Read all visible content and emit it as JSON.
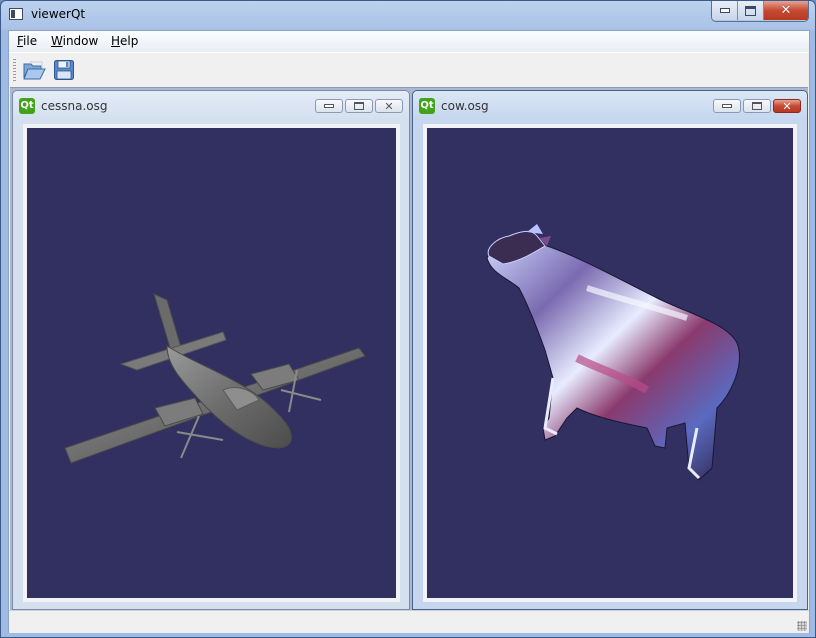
{
  "window": {
    "title": "viewerQt",
    "controls": {
      "minimize": "minimize",
      "maximize": "maximize",
      "close": "close"
    }
  },
  "menubar": {
    "items": [
      {
        "label": "File",
        "mnemonic": "F",
        "rest": "ile"
      },
      {
        "label": "Window",
        "mnemonic": "W",
        "rest": "indow"
      },
      {
        "label": "Help",
        "mnemonic": "H",
        "rest": "elp"
      }
    ]
  },
  "toolbar": {
    "buttons": [
      {
        "name": "open",
        "icon": "folder-open-icon"
      },
      {
        "name": "save",
        "icon": "floppy-disk-icon"
      }
    ]
  },
  "subwindows": [
    {
      "title": "cessna.osg",
      "icon": "qt-logo-icon",
      "logo_text": "Qt",
      "model": "cessna aircraft",
      "active": false
    },
    {
      "title": "cow.osg",
      "icon": "qt-logo-icon",
      "logo_text": "Qt",
      "model": "cow",
      "active": true
    }
  ],
  "colors": {
    "viewport_bg": "#313060",
    "qt_green": "#41a317",
    "close_red": "#c54a32"
  }
}
